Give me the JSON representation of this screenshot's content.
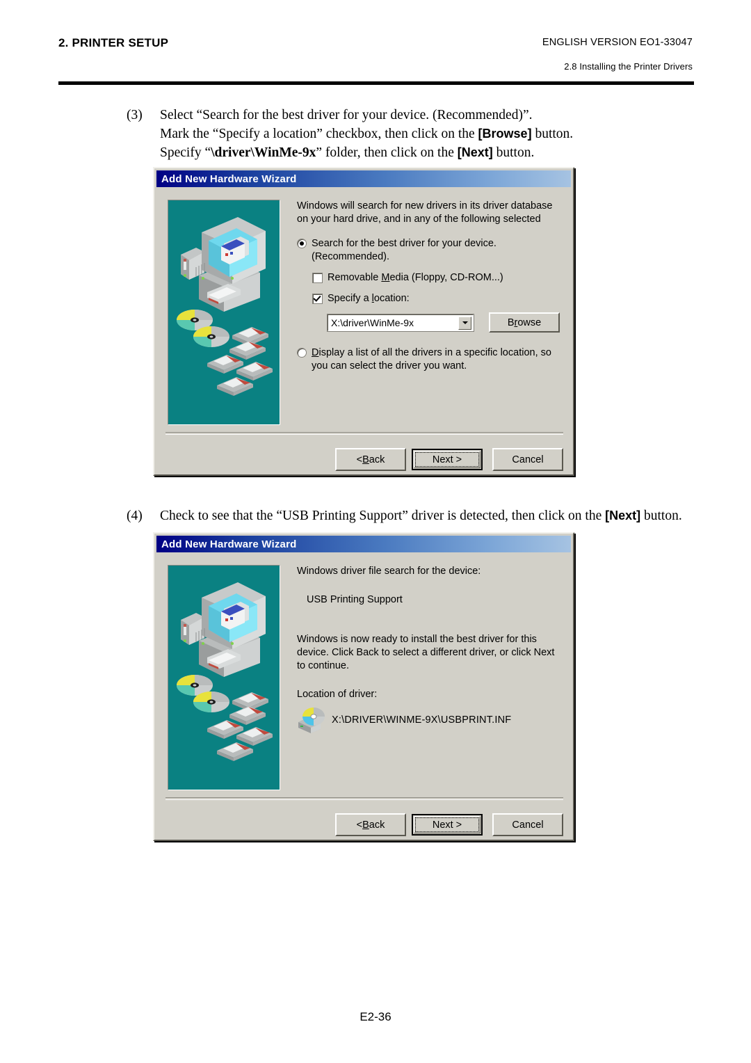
{
  "header": {
    "section_title": "2. PRINTER SETUP",
    "version": "ENGLISH VERSION EO1-33047",
    "subsection": "2.8 Installing the Printer Drivers"
  },
  "steps": [
    {
      "number": "(3)",
      "line1_a": "Select “Search for the best driver for your device. (Recommended)”.",
      "line2_a": "Mark the “Specify a location” checkbox, then click on the ",
      "line2_b": "[Browse]",
      "line2_c": " button.",
      "line3_a": "Specify “",
      "line3_b": "\\driver\\WinMe-9x",
      "line3_c": "” folder, then click on the ",
      "line3_d": "[Next]",
      "line3_e": " button."
    },
    {
      "number": "(4)",
      "line1_a": "Check to see that the “USB Printing Support” driver is detected, then click on the ",
      "line1_b": "[Next]",
      "line1_c": " button."
    }
  ],
  "dialog1": {
    "title": "Add New Hardware Wizard",
    "intro_line1": "Windows will search for new drivers in its driver database",
    "intro_line2": "on your hard drive, and in any of the following selected",
    "radio_best": {
      "line1": "Search for the best driver for your device.",
      "line2": "(Recommended).",
      "selected": true
    },
    "checkbox_removable": {
      "label_pre": "Removable ",
      "label_mnemonic": "M",
      "label_post": "edia (Floppy, CD-ROM...)",
      "checked": false
    },
    "checkbox_location": {
      "label_pre": "Specify a ",
      "label_mnemonic": "l",
      "label_post": "ocation:",
      "checked": true
    },
    "location_combo": {
      "value": "X:\\driver\\WinMe-9x",
      "arrow_icon": "chevron-down-icon"
    },
    "browse_button": {
      "pre": "B",
      "mnemonic": "r",
      "post": "owse"
    },
    "radio_display": {
      "mnemonic": "D",
      "line1_post": "isplay a list of all the drivers in a specific location, so",
      "line2": "you can select the driver you want.",
      "selected": false
    },
    "buttons": {
      "back_pre": "< ",
      "back_mnemonic": "B",
      "back_post": "ack",
      "next": "Next >",
      "cancel": "Cancel"
    },
    "illustration": "computer-cd-floppy-illustration"
  },
  "dialog2": {
    "title": "Add New Hardware Wizard",
    "search_label": "Windows driver file search for the device:",
    "device_name": "USB Printing Support",
    "ready_line1": "Windows is now ready to install the best driver for this",
    "ready_line2": "device. Click Back to select a different driver, or click Next",
    "ready_line3": "to continue.",
    "location_label": "Location of driver:",
    "driver_path": "X:\\DRIVER\\WINME-9X\\USBPRINT.INF",
    "driver_icon": "cd-drive-icon",
    "buttons": {
      "back_pre": "< ",
      "back_mnemonic": "B",
      "back_post": "ack",
      "next": "Next >",
      "cancel": "Cancel"
    },
    "illustration": "computer-cd-floppy-illustration"
  },
  "footer": {
    "page_number": "E2-36"
  },
  "colors": {
    "dialog_face": "#d2d0c8",
    "illustration_teal": "#0a8182",
    "titlebar_dark": "#000084",
    "titlebar_light": "#a6c3e2"
  }
}
